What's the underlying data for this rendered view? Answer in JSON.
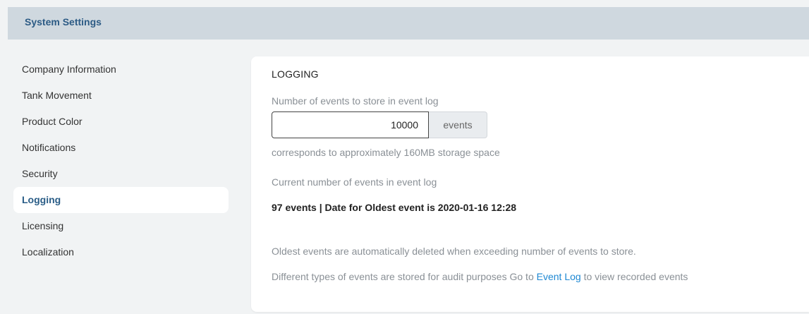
{
  "header": {
    "title": "System Settings"
  },
  "sidebar": {
    "items": [
      {
        "label": "Company Information"
      },
      {
        "label": "Tank Movement"
      },
      {
        "label": "Product Color"
      },
      {
        "label": "Notifications"
      },
      {
        "label": "Security"
      },
      {
        "label": "Logging",
        "active": true
      },
      {
        "label": "Licensing"
      },
      {
        "label": "Localization"
      }
    ]
  },
  "logging": {
    "heading": "LOGGING",
    "events_to_store_label": "Number of events to store in event log",
    "events_to_store_value": "10000",
    "events_unit": "events",
    "storage_hint": "corresponds to approximately 160MB storage space",
    "current_label": "Current number of events in event log",
    "current_value": "97 events | Date for Oldest event is 2020-01-16 12:28",
    "auto_delete_note": "Oldest events are automatically deleted when exceeding number of events to store.",
    "audit_note_prefix": "Different types of events are stored for audit purposes Go to ",
    "audit_note_link": "Event Log",
    "audit_note_suffix": " to view recorded events"
  },
  "colors": {
    "accent": "#2a5d87",
    "link": "#1e88d3",
    "topbar": "#cfd8df",
    "background": "#f1f3f4"
  }
}
